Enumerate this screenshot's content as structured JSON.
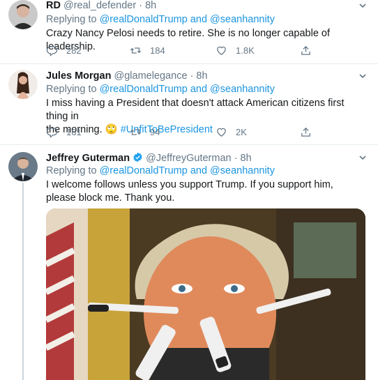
{
  "tweets": [
    {
      "name": "RD",
      "handle": "@real_defender",
      "dot": "·",
      "time": "8h",
      "reply_prefix": "Replying to",
      "reply_user1": "@realDonaldTrump",
      "reply_and": "and",
      "reply_user2": "@seanhannity",
      "text": "Crazy Nancy Pelosi needs to retire. She is no longer capable of leadership.",
      "replies": "282",
      "retweets": "184",
      "likes": "1.8K"
    },
    {
      "name": "Jules Morgan",
      "handle": "@glamelegance",
      "dot": "·",
      "time": "8h",
      "reply_prefix": "Replying to",
      "reply_user1": "@realDonaldTrump",
      "reply_and": "and",
      "reply_user2": "@seanhannity",
      "text_line1": "I miss having a President that doesn't attack American citizens first thing in",
      "text_line2": "the morning.",
      "emoji": "🙄",
      "hashtag": "#UnfitToBePresident",
      "replies": "161",
      "retweets": "94",
      "likes": "2K"
    },
    {
      "name": "Jeffrey Guterman",
      "handle": "@JeffreyGuterman",
      "dot": "·",
      "time": "8h",
      "reply_prefix": "Replying to",
      "reply_user1": "@realDonaldTrump",
      "reply_and": "and",
      "reply_user2": "@seanhannity",
      "text": "I welcome follows unless you support Trump. If you support him, please block me. Thank you."
    }
  ],
  "icons": {
    "reply": "reply-icon",
    "retweet": "retweet-icon",
    "like": "heart-icon",
    "share": "share-icon",
    "caret": "chevron-down-icon",
    "verified": "verified-badge-icon"
  },
  "colors": {
    "link": "#1b95e0",
    "secondary_text": "#657786",
    "separator": "#e6ecf0",
    "verified": "#1da1f2"
  }
}
